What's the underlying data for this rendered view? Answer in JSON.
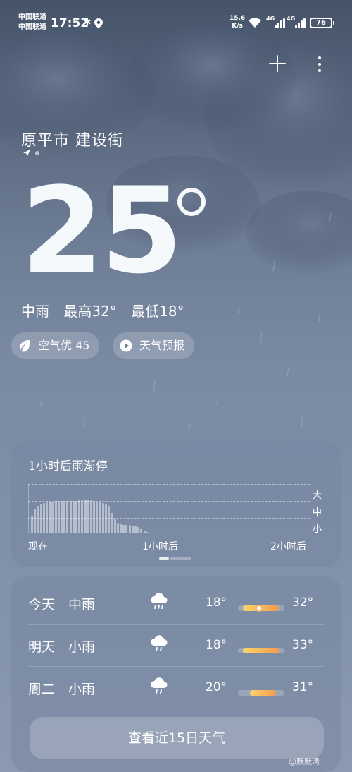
{
  "status_bar": {
    "carrier_1": "中国联通",
    "carrier_2": "中国联通",
    "time": "17:52",
    "net_speed_value": "15.6",
    "net_speed_unit": "K/s",
    "sim1_label": "4G",
    "sim2_label": "4G",
    "battery": "76"
  },
  "location": {
    "name": "原平市 建设街"
  },
  "current": {
    "temp": "25",
    "condition": "中雨",
    "high": "最高32°",
    "low": "最低18°"
  },
  "pills": {
    "air_quality": "空气优 45",
    "forecast_video": "天气预报"
  },
  "rain_card": {
    "title": "1小时后雨渐停",
    "intensity_labels": [
      "大",
      "中",
      "小"
    ],
    "ticks": [
      "现在",
      "1小时后",
      "2小时后"
    ],
    "precip_levels": [
      0.35,
      0.5,
      0.56,
      0.6,
      0.62,
      0.63,
      0.64,
      0.64,
      0.65,
      0.65,
      0.65,
      0.65,
      0.65,
      0.66,
      0.66,
      0.66,
      0.67,
      0.67,
      0.68,
      0.68,
      0.67,
      0.66,
      0.64,
      0.63,
      0.62,
      0.6,
      0.55,
      0.42,
      0.3,
      0.22,
      0.18,
      0.17,
      0.17,
      0.17,
      0.16,
      0.15,
      0.13,
      0.1,
      0.06,
      0.03
    ]
  },
  "forecast": {
    "days": [
      {
        "day": "今天",
        "desc": "中雨",
        "low": "18°",
        "high": "32°",
        "bar_start": 0.1,
        "bar_end": 0.88,
        "now_pos": 0.45
      },
      {
        "day": "明天",
        "desc": "小雨",
        "low": "18°",
        "high": "33°",
        "bar_start": 0.1,
        "bar_end": 0.9
      },
      {
        "day": "周二",
        "desc": "小雨",
        "low": "20°",
        "high": "31°",
        "bar_start": 0.25,
        "bar_end": 0.82
      }
    ],
    "more_button": "查看近15日天气"
  },
  "watermark": "@默默清",
  "colors": {
    "bar_start": "#f9d66b",
    "bar_end": "#f49a4f"
  }
}
